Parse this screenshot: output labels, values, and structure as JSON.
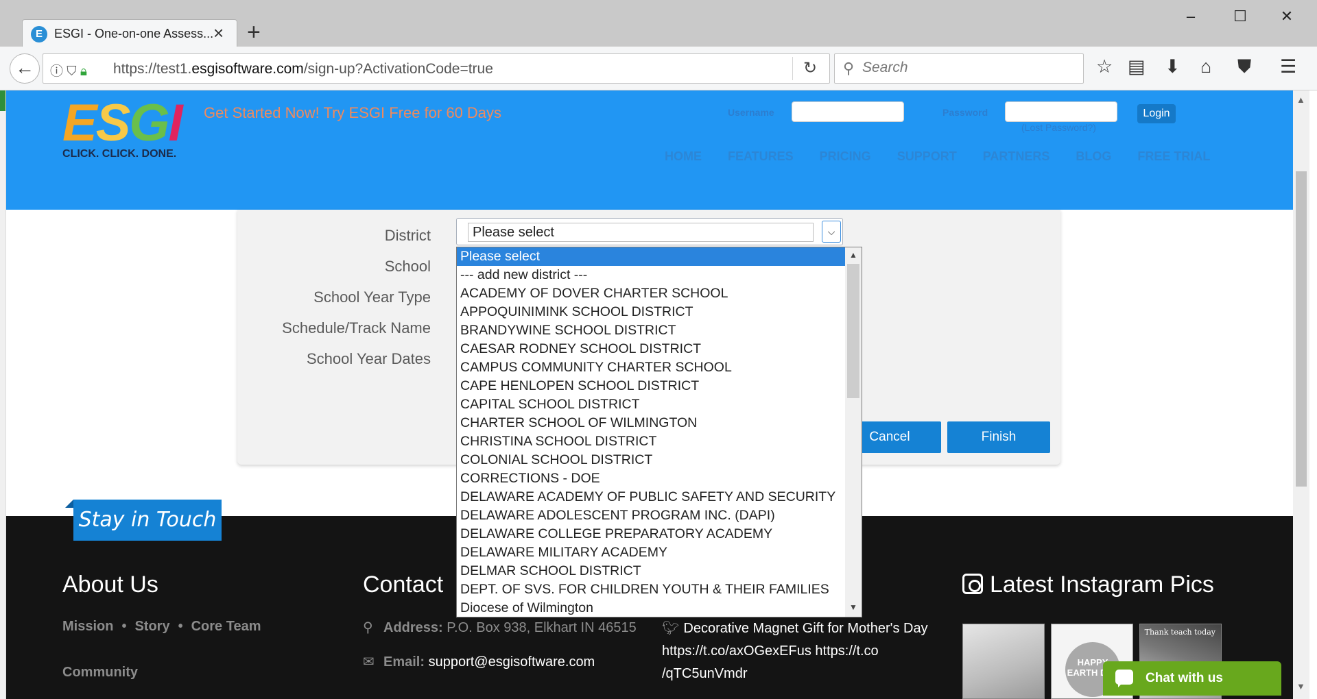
{
  "browser": {
    "tab_title": "ESGI - One-on-one Assess...",
    "favicon_letter": "E",
    "url_prefix": "https://test1.",
    "url_host": "esgisoftware.com",
    "url_path": "/sign-up?ActivationCode=true",
    "search_placeholder": "Search"
  },
  "header": {
    "logo_letters": [
      "E",
      "S",
      "G",
      "I"
    ],
    "logo_tagline": "CLICK. CLICK. DONE.",
    "promo": "Get Started Now! Try ESGI Free for 60 Days",
    "username_label": "Username",
    "password_label": "Password",
    "login_label": "Login",
    "lost_password": "(Lost Password?)",
    "nav": [
      "HOME",
      "FEATURES",
      "PRICING",
      "SUPPORT",
      "PARTNERS",
      "BLOG",
      "FREE TRIAL"
    ]
  },
  "form": {
    "labels": [
      "District",
      "School",
      "School Year Type",
      "Schedule/Track Name",
      "School Year Dates"
    ],
    "district_value": "Please select",
    "cancel_label": "Cancel",
    "finish_label": "Finish"
  },
  "dropdown": {
    "selected_index": 0,
    "options": [
      "Please select",
      "--- add new district ---",
      "ACADEMY OF DOVER CHARTER SCHOOL",
      "APPOQUINIMINK SCHOOL DISTRICT",
      "BRANDYWINE SCHOOL DISTRICT",
      "CAESAR RODNEY SCHOOL DISTRICT",
      "CAMPUS COMMUNITY CHARTER SCHOOL",
      "CAPE HENLOPEN SCHOOL DISTRICT",
      "CAPITAL SCHOOL DISTRICT",
      "CHARTER SCHOOL OF WILMINGTON",
      "CHRISTINA SCHOOL DISTRICT",
      "COLONIAL SCHOOL DISTRICT",
      "CORRECTIONS - DOE",
      "DELAWARE ACADEMY OF PUBLIC SAFETY AND SECURITY",
      "DELAWARE ADOLESCENT PROGRAM INC. (DAPI)",
      "DELAWARE COLLEGE PREPARATORY ACADEMY",
      "DELAWARE MILITARY ACADEMY",
      "DELMAR SCHOOL DISTRICT",
      "DEPT. OF SVS. FOR CHILDREN YOUTH & THEIR FAMILIES",
      "Diocese of Wilmington"
    ]
  },
  "footer": {
    "stay_in_touch": "Stay in Touch",
    "about_heading": "About Us",
    "about_links": [
      "Mission",
      "Story",
      "Core Team"
    ],
    "community": "Community",
    "contact_heading": "Contact",
    "address_label": "Address:",
    "address_value": "P.O. Box 938, Elkhart IN 46515",
    "email_label": "Email:",
    "email_value": "support@esgisoftware.com",
    "tweet_line1": "Decorative Magnet Gift for Mother's Day",
    "tweet_line2": "https://t.co/axOGexEFus https://t.co",
    "tweet_line3": "/qTC5unVmdr",
    "instagram_heading": "Latest Instagram Pics",
    "thumb2_text": "HAPPY EARTH DAY",
    "thumb3_text": "Thank teach today",
    "chat_label": "Chat with us"
  }
}
